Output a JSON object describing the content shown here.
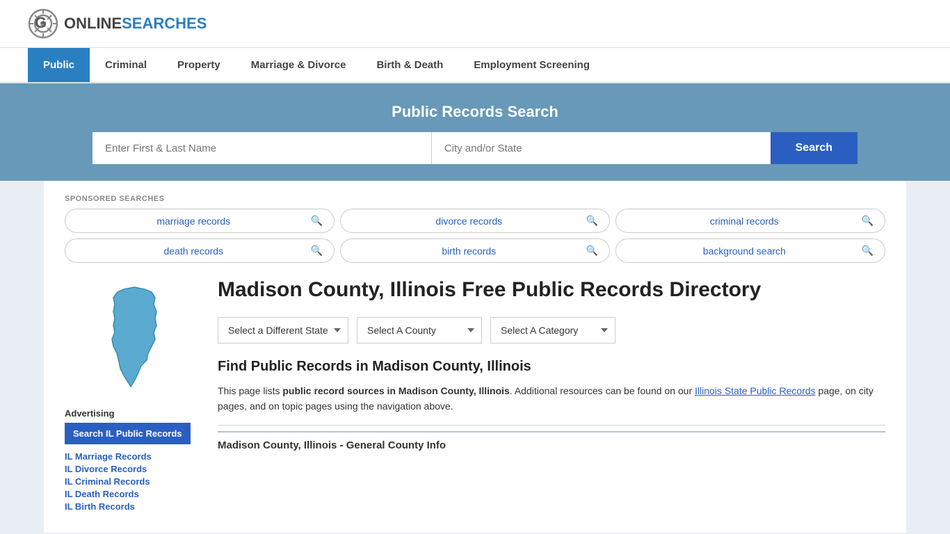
{
  "logo": {
    "online": "ONLINE",
    "searches": "SEARCHES"
  },
  "nav": {
    "items": [
      {
        "label": "Public",
        "active": true
      },
      {
        "label": "Criminal",
        "active": false
      },
      {
        "label": "Property",
        "active": false
      },
      {
        "label": "Marriage & Divorce",
        "active": false
      },
      {
        "label": "Birth & Death",
        "active": false
      },
      {
        "label": "Employment Screening",
        "active": false
      }
    ]
  },
  "search_banner": {
    "title": "Public Records Search",
    "name_placeholder": "Enter First & Last Name",
    "location_placeholder": "City and/or State",
    "search_button": "Search"
  },
  "sponsored": {
    "label": "SPONSORED SEARCHES",
    "tags": [
      {
        "text": "marriage records"
      },
      {
        "text": "divorce records"
      },
      {
        "text": "criminal records"
      },
      {
        "text": "death records"
      },
      {
        "text": "birth records"
      },
      {
        "text": "background search"
      }
    ]
  },
  "sidebar": {
    "advertising_label": "Advertising",
    "ad_button": "Search IL Public Records",
    "links": [
      {
        "text": "IL Marriage Records"
      },
      {
        "text": "IL Divorce Records"
      },
      {
        "text": "IL Criminal Records"
      },
      {
        "text": "IL Death Records"
      },
      {
        "text": "IL Birth Records"
      }
    ]
  },
  "main": {
    "page_title": "Madison County, Illinois Free Public Records Directory",
    "dropdowns": {
      "state": "Select a Different State",
      "county": "Select A County",
      "category": "Select A Category"
    },
    "find_title": "Find Public Records in Madison County, Illinois",
    "find_text_1": "This page lists ",
    "find_text_bold": "public record sources in Madison County, Illinois",
    "find_text_2": ". Additional resources can be found on our ",
    "find_link_text": "Illinois State Public Records",
    "find_text_3": " page, on city pages, and on topic pages using the navigation above.",
    "general_info_title": "Madison County, Illinois - General County Info"
  }
}
